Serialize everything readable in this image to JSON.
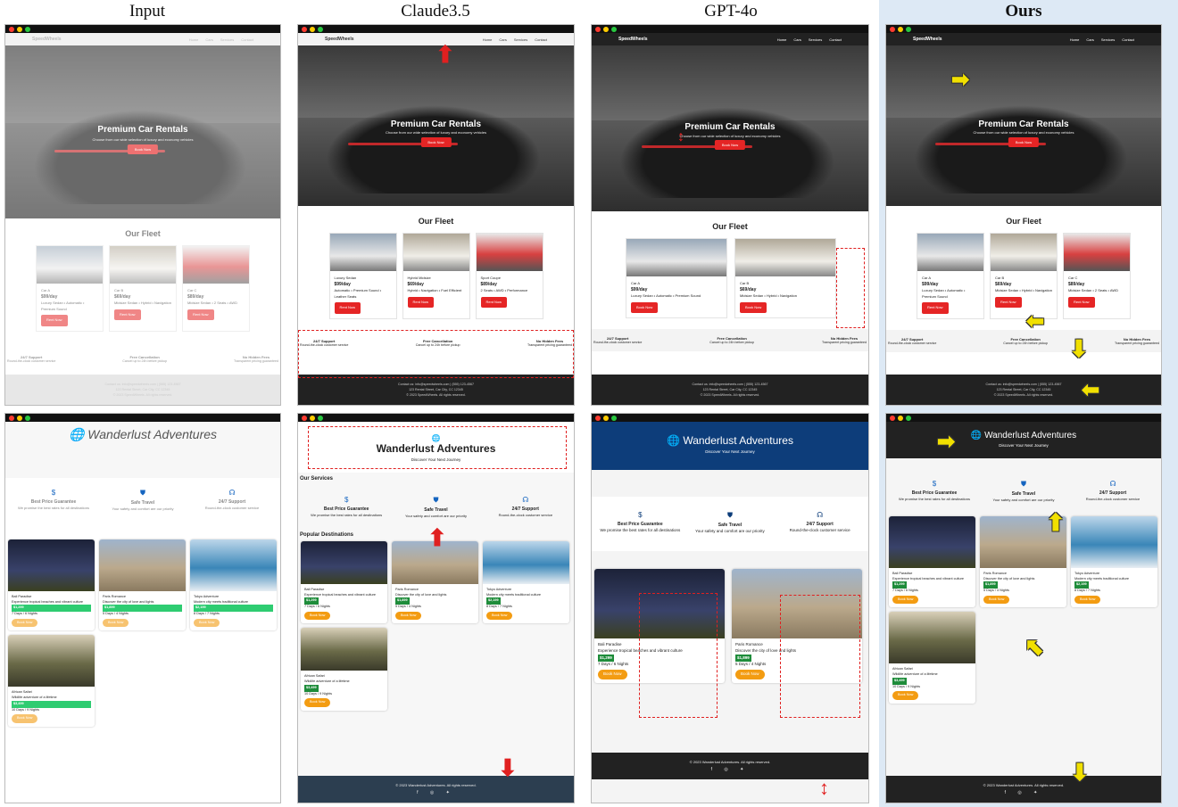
{
  "columns": [
    "Input",
    "Claude3.5",
    "GPT-4o",
    "Ours"
  ],
  "car_site": {
    "brand": "SpeedWheels",
    "nav": [
      "Home",
      "Cars",
      "Services",
      "Contact"
    ],
    "hero_title": "Premium Car Rentals",
    "hero_subtitle": "Choose from our wide selection of luxury and economy vehicles",
    "hero_button": "Book Now",
    "fleet_title": "Our Fleet",
    "cars": [
      {
        "name": "Car A",
        "price": "$99/day",
        "features": "Luxury Sedan • Automatic • Premium Sound"
      },
      {
        "name": "Car B",
        "price": "$69/day",
        "features": "Midsize Sedan • Hybrid • Navigation"
      },
      {
        "name": "Car C",
        "price": "$89/day",
        "features": "Midsize Sedan • 2 Seats • AWD"
      }
    ],
    "cars_claude": [
      {
        "name": "Luxury Sedan",
        "price": "$99/day",
        "features": "Automatic • Premium Sound • Leather Seats"
      },
      {
        "name": "Hybrid Midsize",
        "price": "$69/day",
        "features": "Hybrid • Navigation • Fuel Efficient"
      },
      {
        "name": "Sport Coupe",
        "price": "$89/day",
        "features": "2 Seats • AWD • Performance"
      }
    ],
    "card_button": "Rent Now",
    "features": [
      {
        "title": "24/7 Support",
        "text": "Round-the-clock customer service"
      },
      {
        "title": "Free Cancellation",
        "text": "Cancel up to 24h before pickup"
      },
      {
        "title": "No Hidden Fees",
        "text": "Transparent pricing guaranteed"
      }
    ],
    "footer_lines": [
      "Contact us: info@speedwheels.com | (555) 123-4567",
      "123 Rental Street, Car City, CC 12345",
      "© 2023 SpeedWheels. All rights reserved."
    ]
  },
  "travel_site": {
    "brand": "Wanderlust Adventures",
    "tagline": "Discover Your Next Journey",
    "services_heading": "Our Services",
    "destinations_heading": "Popular Destinations",
    "services": [
      {
        "icon": "$",
        "title": "Best Price Guarantee",
        "text": "We promise the best rates for all destinations"
      },
      {
        "icon": "⛊",
        "title": "Safe Travel",
        "text": "Your safety and comfort are our priority"
      },
      {
        "icon": "☊",
        "title": "24/7 Support",
        "text": "Round-the-clock customer service"
      }
    ],
    "destinations": [
      {
        "name": "Bali Paradise",
        "desc": "Experience tropical beaches and vibrant culture",
        "price": "$1,299",
        "dur": "7 Days / 6 Nights"
      },
      {
        "name": "Paris Romance",
        "desc": "Discover the city of love and lights",
        "price": "$1,899",
        "dur": "5 Days / 4 Nights"
      },
      {
        "name": "Tokyo Adventure",
        "desc": "Modern city meets traditional culture",
        "price": "$2,199",
        "dur": "8 Days / 7 Nights"
      },
      {
        "name": "African Safari",
        "desc": "Wildlife adventure of a lifetime",
        "price": "$3,499",
        "dur": "10 Days / 9 Nights"
      }
    ],
    "book_button": "Book Now",
    "footer": "© 2023 Wanderlust Adventures. All rights reserved.",
    "social": "f ◎ ✦"
  }
}
